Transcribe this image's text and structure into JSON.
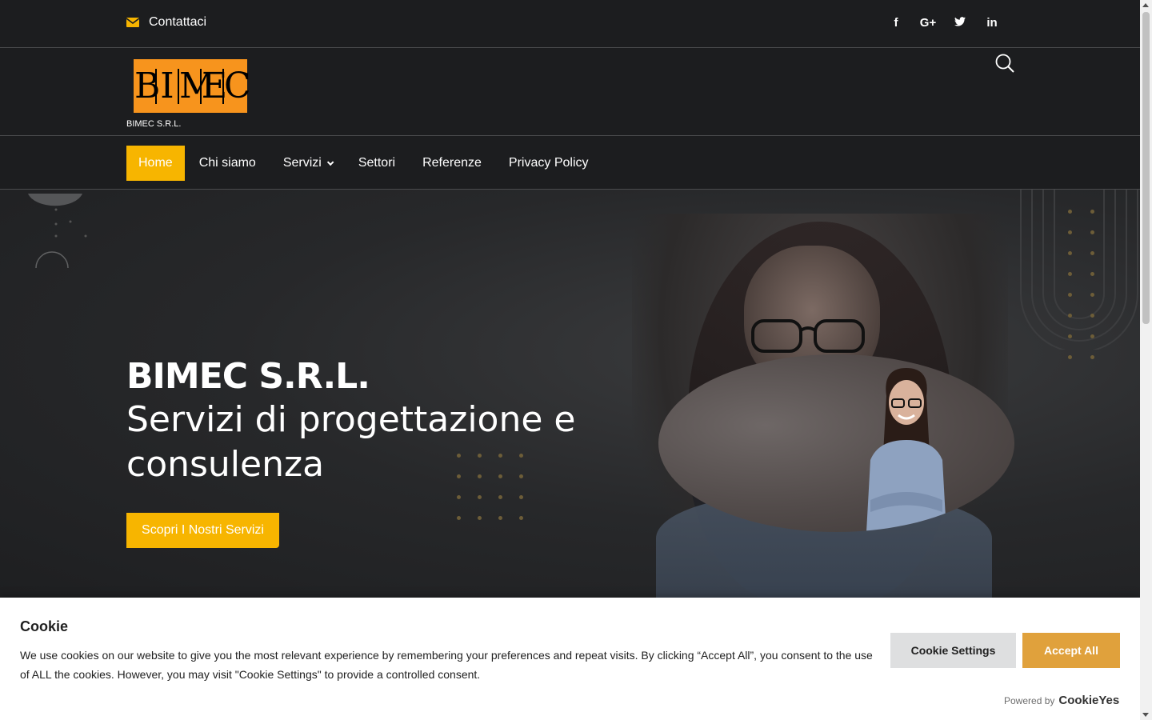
{
  "topbar": {
    "contact_label": "Contattaci",
    "contact_icon": "envelope-icon",
    "socials": [
      {
        "icon": "facebook-icon",
        "glyph": "f"
      },
      {
        "icon": "google-plus-icon",
        "glyph": "G+"
      },
      {
        "icon": "twitter-icon",
        "glyph": "🐦"
      },
      {
        "icon": "linkedin-icon",
        "glyph": "in"
      }
    ]
  },
  "header": {
    "logo_letters": [
      "B",
      "I",
      "M",
      "E",
      "C"
    ],
    "brand_name": "BIMEC S.R.L.",
    "search_icon": "search-icon"
  },
  "nav": {
    "items": [
      {
        "label": "Home",
        "active": true
      },
      {
        "label": "Chi siamo"
      },
      {
        "label": "Servizi",
        "dropdown": true
      },
      {
        "label": "Settori"
      },
      {
        "label": "Referenze"
      },
      {
        "label": "Privacy Policy"
      }
    ]
  },
  "hero": {
    "title": "BIMEC S.R.L.",
    "subtitle": "Servizi di progettazione e consulenza",
    "cta_label": "Scopri I Nostri Servizi"
  },
  "cookie": {
    "title": "Cookie",
    "text": "We use cookies on our website to give you the most relevant experience by remembering your preferences and repeat visits. By clicking “Accept All”, you consent to the use of ALL the cookies. However, you may visit \"Cookie Settings\" to provide a controlled consent.",
    "settings_label": "Cookie Settings",
    "accept_label": "Accept All",
    "powered_label": "Powered by",
    "powered_brand": "CookieYes"
  },
  "colors": {
    "accent": "#f7b500",
    "logo_orange": "#f7941d",
    "dark_bg": "#1c1d1f",
    "accept_button": "#e0a13c"
  }
}
